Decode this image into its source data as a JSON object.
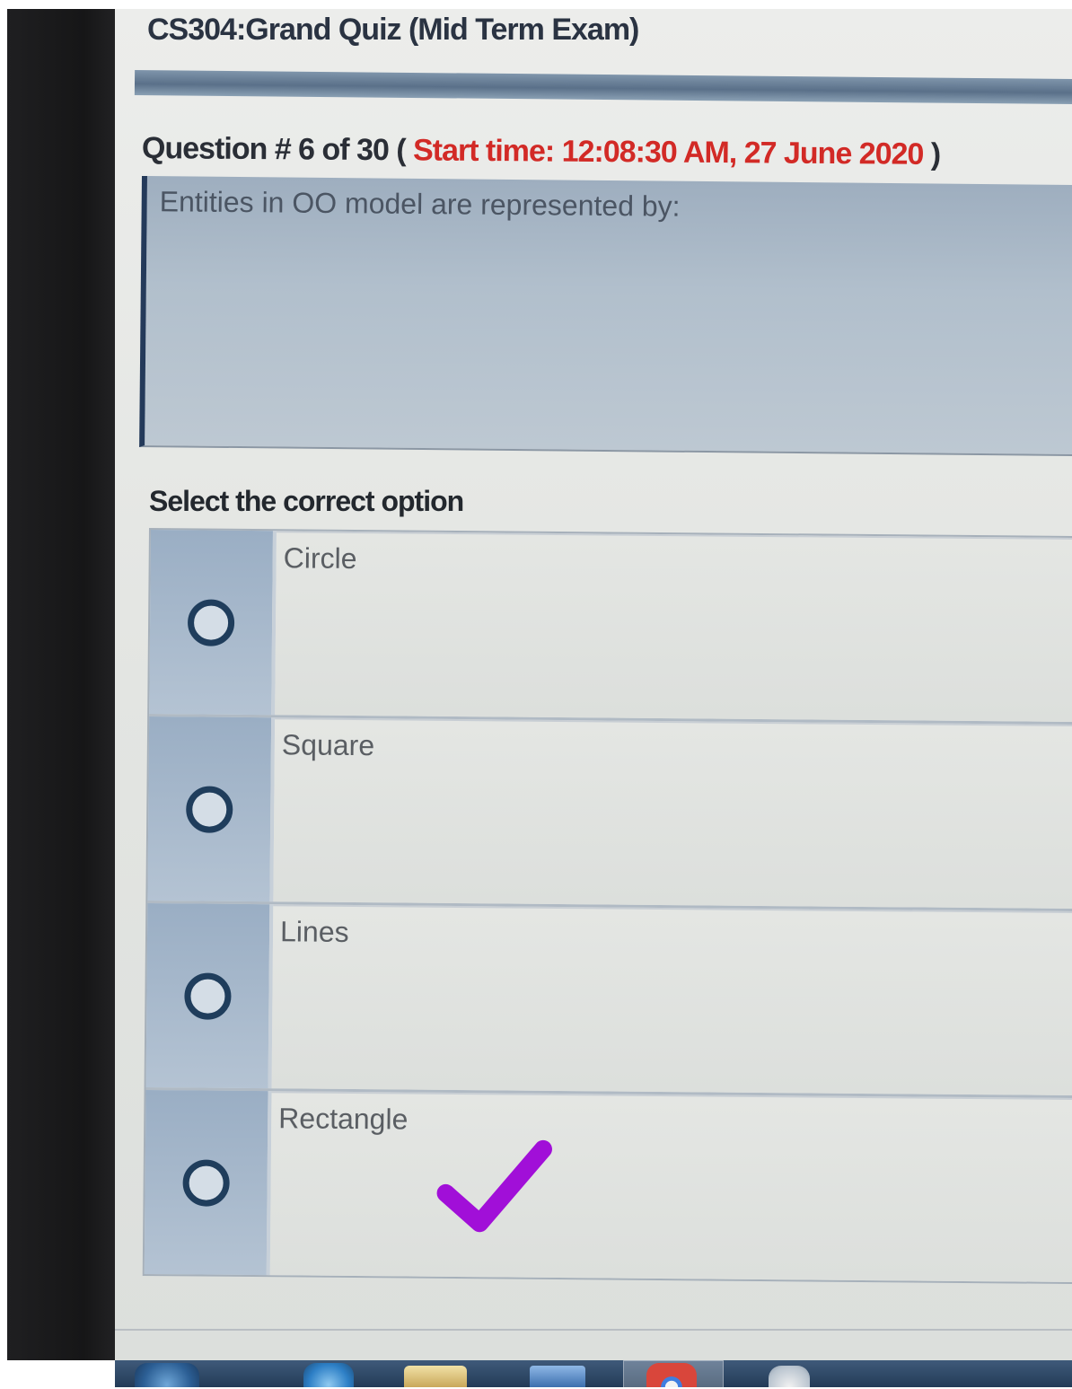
{
  "quiz": {
    "title": "CS304:Grand Quiz (Mid Term Exam)"
  },
  "question": {
    "prefix": "Question # 6 of 30 (",
    "start_time": "Start time: 12:08:30 AM, 27 June 2020",
    "suffix": ")",
    "text": "Entities in OO model are represented by:"
  },
  "options": {
    "instruction": "Select the correct option",
    "items": [
      {
        "label": "Circle"
      },
      {
        "label": "Square"
      },
      {
        "label": "Lines"
      },
      {
        "label": "Rectangle",
        "checkmark": true
      }
    ]
  },
  "colors": {
    "start_time": "#d22a26",
    "checkmark": "#a10fd8",
    "radio": "#1f3d5c"
  },
  "taskbar": {
    "icons": [
      "start-orb-icon",
      "ie-browser-icon",
      "folder-icon",
      "app-icon",
      "chrome-icon",
      "misc-app-icon"
    ]
  }
}
